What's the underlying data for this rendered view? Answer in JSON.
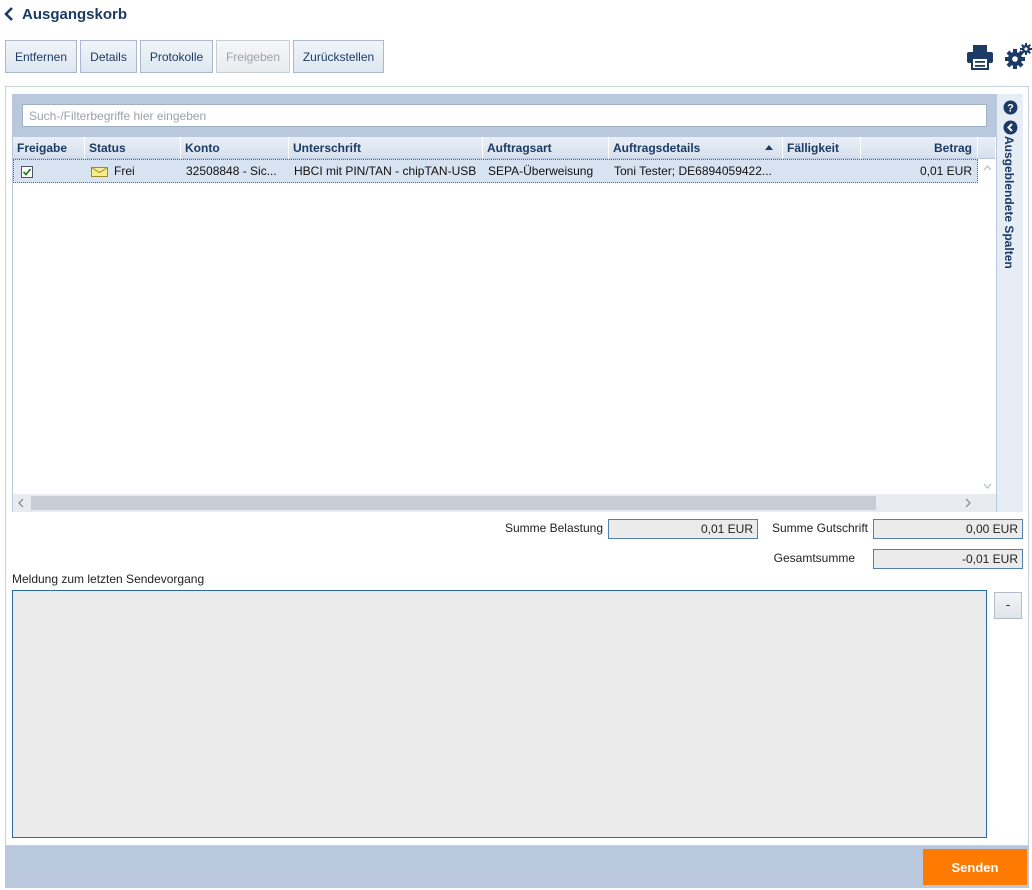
{
  "header": {
    "title": "Ausgangskorb"
  },
  "toolbar": {
    "remove": "Entfernen",
    "details": "Details",
    "logs": "Protokolle",
    "release": "Freigeben",
    "defer": "Zurückstellen"
  },
  "search": {
    "placeholder": "Such-/Filterbegriffe hier eingeben"
  },
  "table": {
    "columns": [
      "Freigabe",
      "Status",
      "Konto",
      "Unterschrift",
      "Auftragsart",
      "Auftragsdetails",
      "Fälligkeit",
      "Betrag"
    ],
    "sort_column": "Auftragsdetails",
    "sort_direction": "ascending",
    "rows": [
      {
        "freigabe_checked": true,
        "status": "Frei",
        "konto": "32508848 - Sic...",
        "unterschrift": "HBCI mit PIN/TAN - chipTAN-USB",
        "auftragsart": "SEPA-Überweisung",
        "auftragsdetails": "Toni Tester; DE6894059422...",
        "faelligkeit": "",
        "betrag": "0,01 EUR"
      }
    ]
  },
  "side_panel": {
    "label": "Ausgeblendete Spalten"
  },
  "totals": {
    "debit_label": "Summe Belastung",
    "debit_value": "0,01 EUR",
    "credit_label": "Summe Gutschrift",
    "credit_value": "0,00 EUR",
    "total_label": "Gesamtsumme",
    "total_value": "-0,01 EUR"
  },
  "message": {
    "label": "Meldung zum letzten Sendevorgang",
    "collapse": "-"
  },
  "footer": {
    "send": "Senden"
  },
  "colors": {
    "accent": "#ff7a00",
    "header_bg": "#b9c8dc",
    "title": "#1b3b66"
  }
}
